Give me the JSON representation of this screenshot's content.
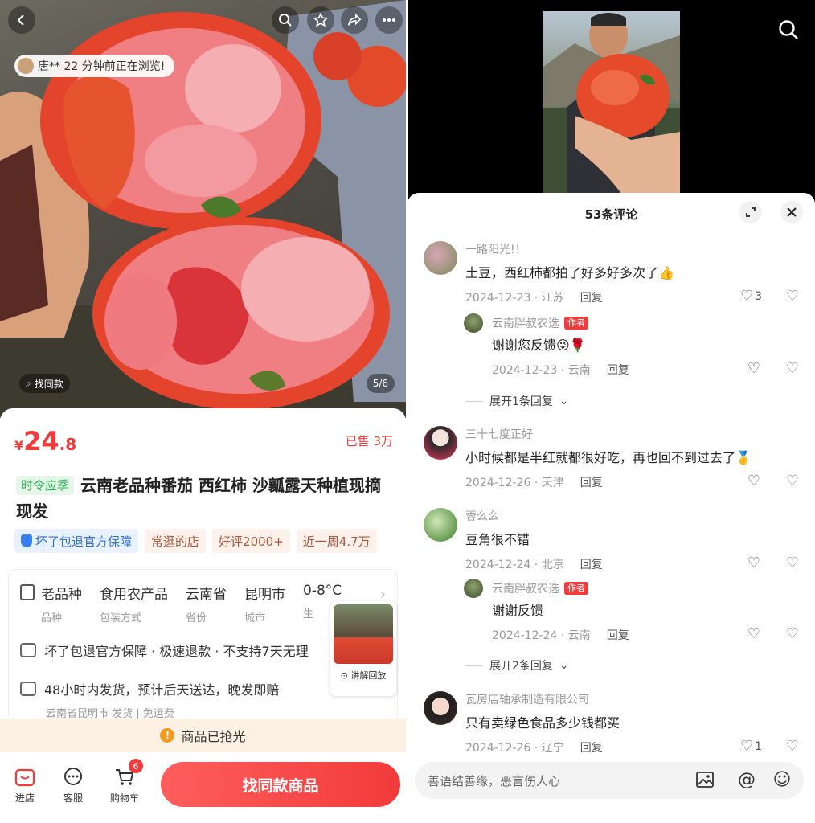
{
  "product": {
    "browsing_notice": "唐** 22 分钟前正在浏览!",
    "find_same_small": "找同款",
    "image_counter": "5/6",
    "price_currency": "¥",
    "price_int": "24",
    "price_dec": ".8",
    "sold": "已售 3万",
    "season_tag": "时令应季",
    "title": "云南老品种番茄 西红柿 沙瓤露天种植现摘现发",
    "tags": [
      "坏了包退官方保障",
      "常逛的店",
      "好评2000+",
      "近一周4.7万"
    ],
    "specs": [
      {
        "value": "老品种",
        "key": "品种"
      },
      {
        "value": "食用农产品",
        "key": "包装方式"
      },
      {
        "value": "云南省",
        "key": "省份"
      },
      {
        "value": "昆明市",
        "key": "城市"
      },
      {
        "value": "0-8°C",
        "key": "生"
      }
    ],
    "service_guarantee": "坏了包退官方保障 · 极速退款 · 不支持7天无理",
    "service_shipping": "48小时内发货，预计后天送达，晚发即赔",
    "service_origin": "云南省昆明市 发货 | 免运费",
    "mini_video_label": "讲解回放",
    "soldout_notice": "商品已抢光"
  },
  "bottom_bar": {
    "store": "进店",
    "service": "客服",
    "cart": "购物车",
    "cart_badge": "6",
    "find_same_button": "找同款商品"
  },
  "comments_panel": {
    "title": "53条评论",
    "input_placeholder": "善语结善缘，恶言伤人心",
    "comments": [
      {
        "name": "一路阳光!！",
        "text": "土豆，西红柿都拍了好多好多次了👍",
        "date": "2024-12-23 · 江苏",
        "reply": "回复",
        "likes": "3"
      },
      {
        "name": "云南胖叔农选",
        "author_tag": "作者",
        "text": "谢谢您反馈😜🌹",
        "date": "2024-12-23 · 云南",
        "reply": "回复",
        "likes": ""
      },
      {
        "expand": "展开1条回复"
      },
      {
        "name": "三十七度正好",
        "text": "小时候都是半红就都很好吃，再也回不到过去了🥇",
        "date": "2024-12-26 · 天津",
        "reply": "回复",
        "likes": ""
      },
      {
        "name": "蓉么么",
        "text": "豆角很不错",
        "date": "2024-12-24 · 北京",
        "reply": "回复",
        "likes": ""
      },
      {
        "name": "云南胖叔农选",
        "author_tag": "作者",
        "text": "谢谢反馈",
        "date": "2024-12-24 · 云南",
        "reply": "回复",
        "likes": ""
      },
      {
        "expand": "展开2条回复"
      },
      {
        "name": "瓦房店轴承制造有限公司",
        "text": "只有卖绿色食品多少钱都买",
        "date": "2024-12-26 · 辽宁",
        "reply": "回复",
        "likes": "1"
      }
    ]
  }
}
